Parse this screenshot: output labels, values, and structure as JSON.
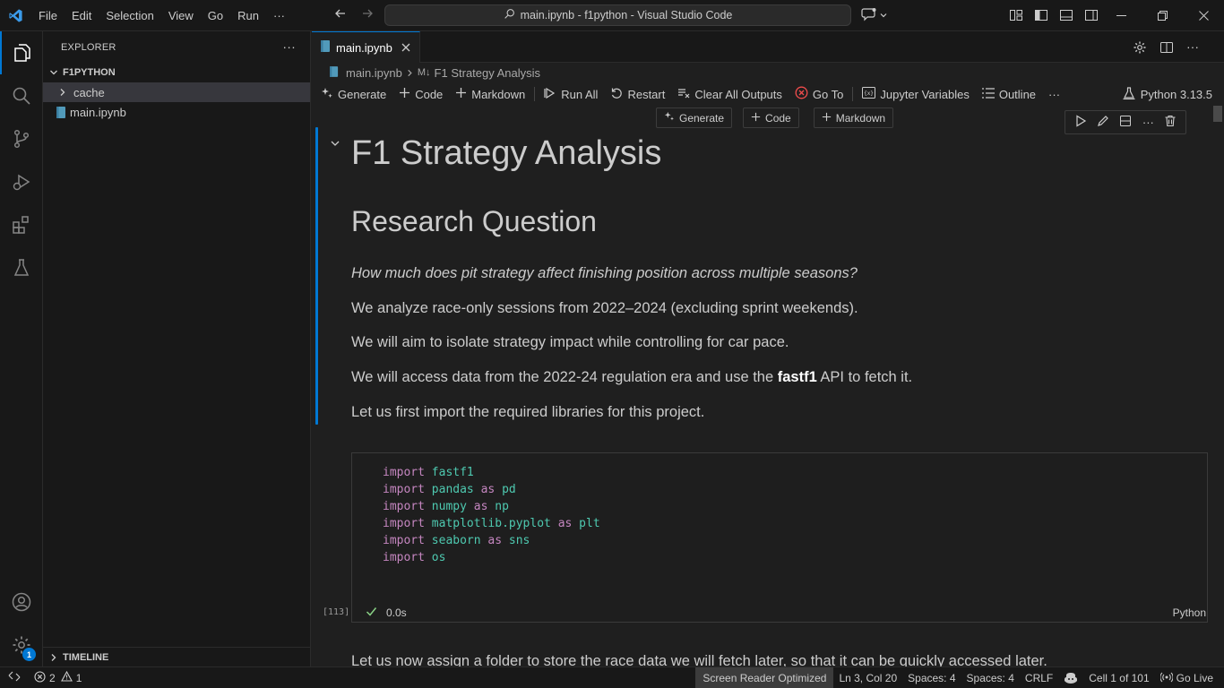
{
  "titlebar": {
    "menu": [
      "File",
      "Edit",
      "Selection",
      "View",
      "Go",
      "Run",
      "···"
    ],
    "search_text": "main.ipynb - f1python - Visual Studio Code"
  },
  "sidebar": {
    "title": "EXPLORER",
    "more": "···",
    "root": "F1PYTHON",
    "items": [
      {
        "label": "cache",
        "type": "folder"
      },
      {
        "label": "main.ipynb",
        "type": "notebook"
      }
    ],
    "timeline": "TIMELINE"
  },
  "activity": {
    "settings_badge": "1"
  },
  "editor": {
    "tab_label": "main.ipynb",
    "breadcrumb": {
      "file": "main.ipynb",
      "section": "F1 Strategy Analysis"
    },
    "toolbar": {
      "generate": "Generate",
      "code": "Code",
      "markdown": "Markdown",
      "run_all": "Run All",
      "restart": "Restart",
      "clear_outputs": "Clear All Outputs",
      "go_to": "Go To",
      "variables": "Jupyter Variables",
      "outline": "Outline",
      "more": "···",
      "kernel": "Python 3.13.5"
    },
    "insert": {
      "generate": "Generate",
      "code": "Code",
      "markdown": "Markdown"
    },
    "markdown_cell": {
      "h1": "F1 Strategy Analysis",
      "h2": "Research Question",
      "question": "How much does pit strategy affect finishing position across multiple seasons?",
      "p1": "We analyze race-only sessions from 2022–2024 (excluding sprint weekends).",
      "p2": "We will aim to isolate strategy impact while controlling for car pace.",
      "p3_before": "We will access data from the 2022-24 regulation era and use the ",
      "p3_bold": "fastf1",
      "p3_after": " API to fetch it.",
      "p4": "Let us first import the required libraries for this project."
    },
    "code_cell": {
      "lines": [
        {
          "kw": "import",
          "mod": "fastf1",
          "as": "",
          "alias": ""
        },
        {
          "kw": "import",
          "mod": "pandas",
          "as": "as",
          "alias": "pd"
        },
        {
          "kw": "import",
          "mod": "numpy",
          "as": "as",
          "alias": "np"
        },
        {
          "kw": "import",
          "mod": "matplotlib.pyplot",
          "as": "as",
          "alias": "plt"
        },
        {
          "kw": "import",
          "mod": "seaborn",
          "as": "as",
          "alias": "sns"
        },
        {
          "kw": "import",
          "mod": "os",
          "as": "",
          "alias": ""
        }
      ],
      "exec_count": "[113]",
      "duration": "0.0s",
      "language": "Python"
    },
    "next_text": "Let us now assign a folder to store the race data we will fetch later, so that it can be quickly accessed later."
  },
  "statusbar": {
    "errors": "2",
    "warnings": "1",
    "screen_reader": "Screen Reader Optimized",
    "position": "Ln 3, Col 20",
    "spaces1": "Spaces: 4",
    "spaces2": "Spaces: 4",
    "eol": "CRLF",
    "cell": "Cell 1 of 101",
    "golive": "Go Live"
  },
  "colors": {
    "accent": "#0078d4",
    "keyword": "#c586c0",
    "module": "#4ec9b0",
    "success": "#89d185",
    "error": "#f14c4c"
  }
}
